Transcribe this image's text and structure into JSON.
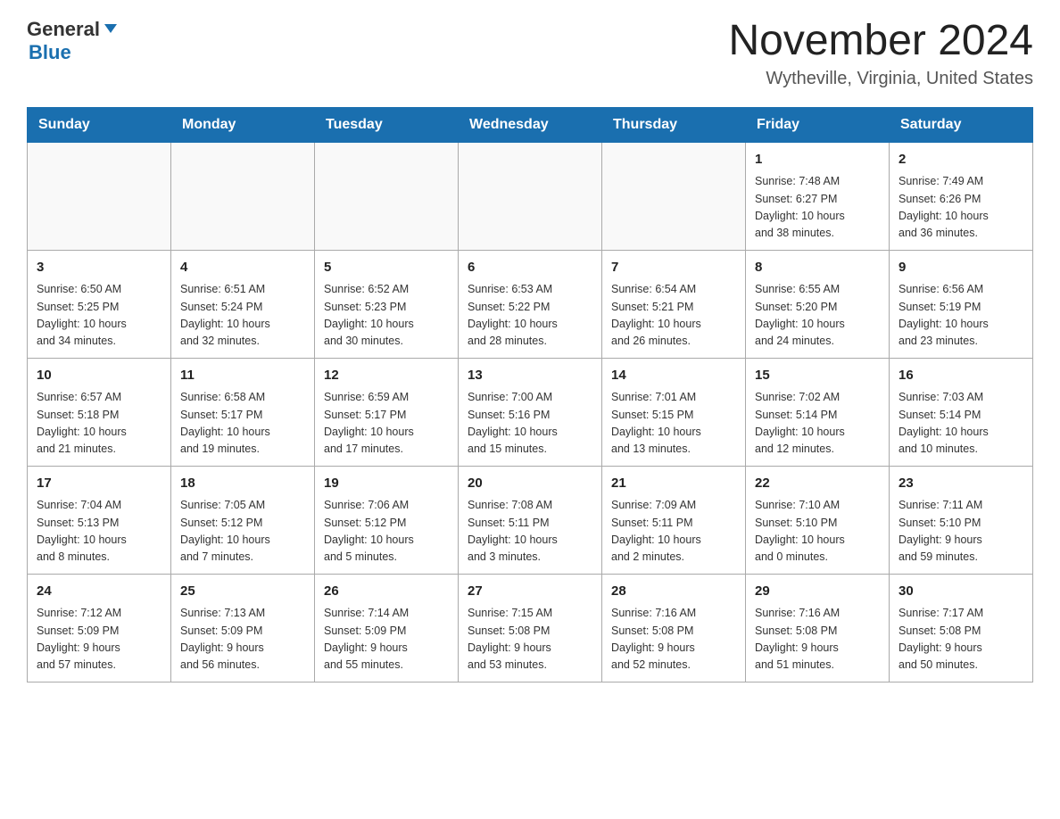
{
  "header": {
    "logo_general": "General",
    "logo_blue": "Blue",
    "title": "November 2024",
    "subtitle": "Wytheville, Virginia, United States"
  },
  "weekdays": [
    "Sunday",
    "Monday",
    "Tuesday",
    "Wednesday",
    "Thursday",
    "Friday",
    "Saturday"
  ],
  "weeks": [
    [
      {
        "day": "",
        "info": ""
      },
      {
        "day": "",
        "info": ""
      },
      {
        "day": "",
        "info": ""
      },
      {
        "day": "",
        "info": ""
      },
      {
        "day": "",
        "info": ""
      },
      {
        "day": "1",
        "info": "Sunrise: 7:48 AM\nSunset: 6:27 PM\nDaylight: 10 hours\nand 38 minutes."
      },
      {
        "day": "2",
        "info": "Sunrise: 7:49 AM\nSunset: 6:26 PM\nDaylight: 10 hours\nand 36 minutes."
      }
    ],
    [
      {
        "day": "3",
        "info": "Sunrise: 6:50 AM\nSunset: 5:25 PM\nDaylight: 10 hours\nand 34 minutes."
      },
      {
        "day": "4",
        "info": "Sunrise: 6:51 AM\nSunset: 5:24 PM\nDaylight: 10 hours\nand 32 minutes."
      },
      {
        "day": "5",
        "info": "Sunrise: 6:52 AM\nSunset: 5:23 PM\nDaylight: 10 hours\nand 30 minutes."
      },
      {
        "day": "6",
        "info": "Sunrise: 6:53 AM\nSunset: 5:22 PM\nDaylight: 10 hours\nand 28 minutes."
      },
      {
        "day": "7",
        "info": "Sunrise: 6:54 AM\nSunset: 5:21 PM\nDaylight: 10 hours\nand 26 minutes."
      },
      {
        "day": "8",
        "info": "Sunrise: 6:55 AM\nSunset: 5:20 PM\nDaylight: 10 hours\nand 24 minutes."
      },
      {
        "day": "9",
        "info": "Sunrise: 6:56 AM\nSunset: 5:19 PM\nDaylight: 10 hours\nand 23 minutes."
      }
    ],
    [
      {
        "day": "10",
        "info": "Sunrise: 6:57 AM\nSunset: 5:18 PM\nDaylight: 10 hours\nand 21 minutes."
      },
      {
        "day": "11",
        "info": "Sunrise: 6:58 AM\nSunset: 5:17 PM\nDaylight: 10 hours\nand 19 minutes."
      },
      {
        "day": "12",
        "info": "Sunrise: 6:59 AM\nSunset: 5:17 PM\nDaylight: 10 hours\nand 17 minutes."
      },
      {
        "day": "13",
        "info": "Sunrise: 7:00 AM\nSunset: 5:16 PM\nDaylight: 10 hours\nand 15 minutes."
      },
      {
        "day": "14",
        "info": "Sunrise: 7:01 AM\nSunset: 5:15 PM\nDaylight: 10 hours\nand 13 minutes."
      },
      {
        "day": "15",
        "info": "Sunrise: 7:02 AM\nSunset: 5:14 PM\nDaylight: 10 hours\nand 12 minutes."
      },
      {
        "day": "16",
        "info": "Sunrise: 7:03 AM\nSunset: 5:14 PM\nDaylight: 10 hours\nand 10 minutes."
      }
    ],
    [
      {
        "day": "17",
        "info": "Sunrise: 7:04 AM\nSunset: 5:13 PM\nDaylight: 10 hours\nand 8 minutes."
      },
      {
        "day": "18",
        "info": "Sunrise: 7:05 AM\nSunset: 5:12 PM\nDaylight: 10 hours\nand 7 minutes."
      },
      {
        "day": "19",
        "info": "Sunrise: 7:06 AM\nSunset: 5:12 PM\nDaylight: 10 hours\nand 5 minutes."
      },
      {
        "day": "20",
        "info": "Sunrise: 7:08 AM\nSunset: 5:11 PM\nDaylight: 10 hours\nand 3 minutes."
      },
      {
        "day": "21",
        "info": "Sunrise: 7:09 AM\nSunset: 5:11 PM\nDaylight: 10 hours\nand 2 minutes."
      },
      {
        "day": "22",
        "info": "Sunrise: 7:10 AM\nSunset: 5:10 PM\nDaylight: 10 hours\nand 0 minutes."
      },
      {
        "day": "23",
        "info": "Sunrise: 7:11 AM\nSunset: 5:10 PM\nDaylight: 9 hours\nand 59 minutes."
      }
    ],
    [
      {
        "day": "24",
        "info": "Sunrise: 7:12 AM\nSunset: 5:09 PM\nDaylight: 9 hours\nand 57 minutes."
      },
      {
        "day": "25",
        "info": "Sunrise: 7:13 AM\nSunset: 5:09 PM\nDaylight: 9 hours\nand 56 minutes."
      },
      {
        "day": "26",
        "info": "Sunrise: 7:14 AM\nSunset: 5:09 PM\nDaylight: 9 hours\nand 55 minutes."
      },
      {
        "day": "27",
        "info": "Sunrise: 7:15 AM\nSunset: 5:08 PM\nDaylight: 9 hours\nand 53 minutes."
      },
      {
        "day": "28",
        "info": "Sunrise: 7:16 AM\nSunset: 5:08 PM\nDaylight: 9 hours\nand 52 minutes."
      },
      {
        "day": "29",
        "info": "Sunrise: 7:16 AM\nSunset: 5:08 PM\nDaylight: 9 hours\nand 51 minutes."
      },
      {
        "day": "30",
        "info": "Sunrise: 7:17 AM\nSunset: 5:08 PM\nDaylight: 9 hours\nand 50 minutes."
      }
    ]
  ]
}
